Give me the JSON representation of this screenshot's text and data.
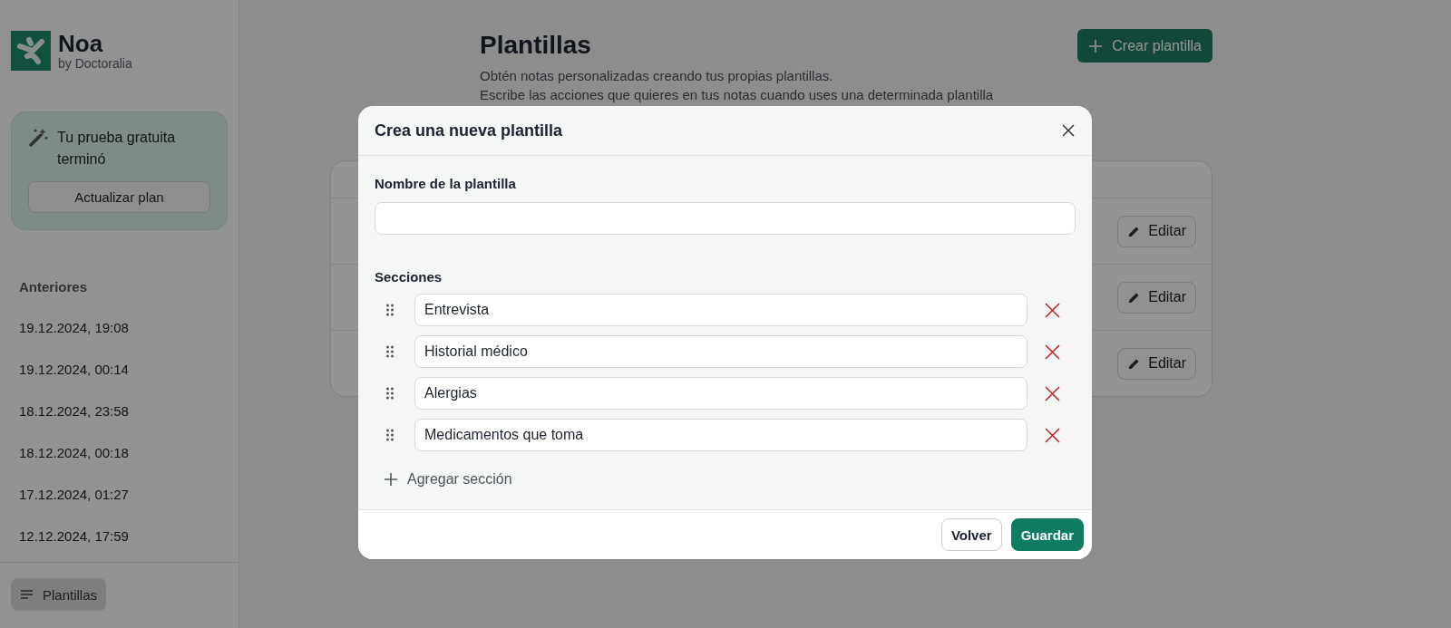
{
  "sidebar": {
    "logo": {
      "name": "Noa",
      "byline": "by Doctoralia"
    },
    "trial_card": {
      "message": "Tu prueba gratuita terminó",
      "button": "Actualizar plan"
    },
    "history": {
      "heading": "Anteriores",
      "items": [
        "19.12.2024, 19:08",
        "19.12.2024, 00:14",
        "18.12.2024, 23:58",
        "18.12.2024, 00:18",
        "17.12.2024, 01:27",
        "12.12.2024, 17:59"
      ]
    },
    "nav": [
      {
        "label": "Plantillas",
        "selected": true
      }
    ]
  },
  "main": {
    "title": "Plantillas",
    "create_button": "Crear plantilla",
    "description": [
      "Obtén notas personalizadas creando tus propias plantillas.",
      "Escribe las acciones que quieres en tus notas cuando uses una determinada plantilla"
    ],
    "templates": [
      {
        "action": "Editar"
      },
      {
        "action": "Editar"
      },
      {
        "action": "Editar"
      }
    ]
  },
  "modal": {
    "title": "Crea una nueva plantilla",
    "name_field": {
      "label": "Nombre de la plantilla"
    },
    "sections_label": "Secciones",
    "sections": [
      {
        "value": "Entrevista"
      },
      {
        "value": "Historial médico"
      },
      {
        "value": "Alergias"
      },
      {
        "value": "Medicamentos que toma"
      }
    ],
    "add_button": "Agregar sección",
    "buttons": [
      {
        "label": "Volver",
        "kind": "secondary"
      },
      {
        "label": "Guardar",
        "kind": "primary"
      }
    ]
  }
}
